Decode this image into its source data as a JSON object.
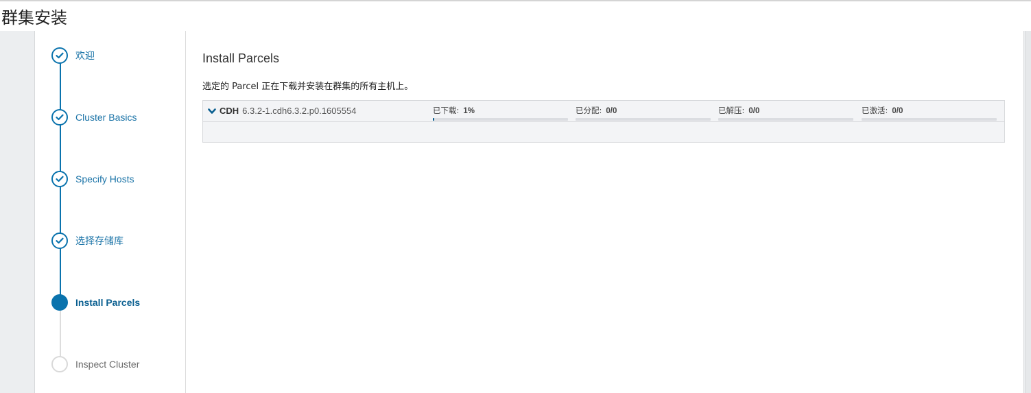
{
  "page": {
    "title": "群集安装"
  },
  "colors": {
    "accent": "#0a73ad",
    "pending": "#d9d9d9",
    "progress": "#0a5f90"
  },
  "steps": [
    {
      "label": "欢迎",
      "state": "done",
      "icon": "check-circle-icon"
    },
    {
      "label": "Cluster Basics",
      "state": "done",
      "icon": "check-circle-icon"
    },
    {
      "label": "Specify Hosts",
      "state": "done",
      "icon": "check-circle-icon"
    },
    {
      "label": "选择存储库",
      "state": "done",
      "icon": "check-circle-icon"
    },
    {
      "label": "Install Parcels",
      "state": "current",
      "icon": "filled-circle-icon"
    },
    {
      "label": "Inspect Cluster",
      "state": "pending",
      "icon": "empty-circle-icon"
    }
  ],
  "main": {
    "title": "Install Parcels",
    "description": "选定的 Parcel 正在下载并安装在群集的所有主机上。"
  },
  "parcel": {
    "name": "CDH",
    "version": "6.3.2-1.cdh6.3.2.p0.1605554",
    "expand_icon": "chevron-down-icon",
    "stats": [
      {
        "label": "已下载:",
        "value": "1%",
        "progress": 0.01
      },
      {
        "label": "已分配:",
        "value": "0/0",
        "progress": 0
      },
      {
        "label": "已解压:",
        "value": "0/0",
        "progress": 0
      },
      {
        "label": "已激活:",
        "value": "0/0",
        "progress": 0
      }
    ]
  }
}
